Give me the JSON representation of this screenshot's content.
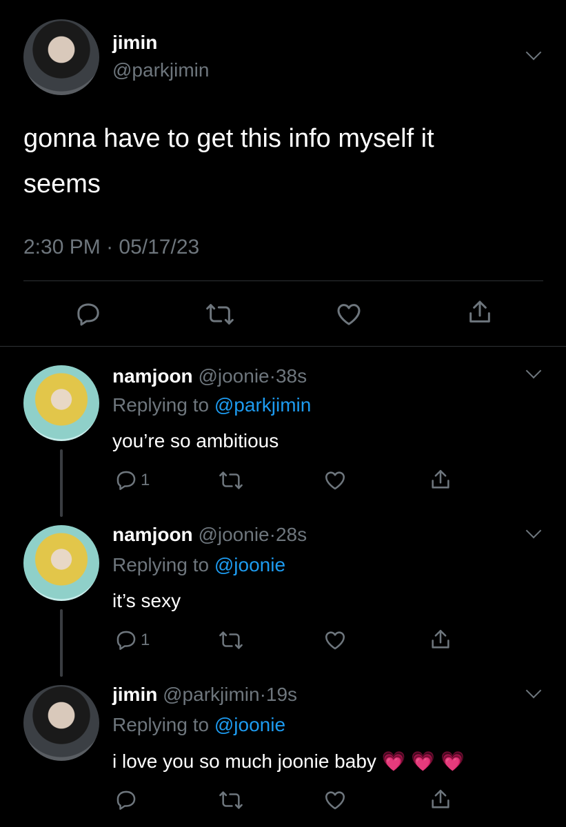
{
  "main_tweet": {
    "name": "jimin",
    "handle": "@parkjimin",
    "text_line1": "gonna have to get this info myself it",
    "text_line2": "seems",
    "time": "2:30 PM",
    "separator": "·",
    "date": "05/17/23"
  },
  "replies": [
    {
      "name": "namjoon",
      "handle": "@joonie",
      "dot": "·",
      "age": "38s",
      "replying_prefix": "Replying to",
      "replying_to": "@parkjimin",
      "text": "you’re so ambitious",
      "reply_count": "1"
    },
    {
      "name": "namjoon",
      "handle": "@joonie",
      "dot": "·",
      "age": "28s",
      "replying_prefix": "Replying to",
      "replying_to": "@joonie",
      "text": "it’s sexy",
      "reply_count": "1"
    },
    {
      "name": "jimin",
      "handle": "@parkjimin",
      "dot": "·",
      "age": "19s",
      "replying_prefix": "Replying to",
      "replying_to": "@joonie",
      "text": "i love you so much joonie baby",
      "emoji": "💗 💗 💗"
    }
  ],
  "colors": {
    "background": "#000000",
    "muted": "#6e767d",
    "link": "#1d9bf0"
  }
}
